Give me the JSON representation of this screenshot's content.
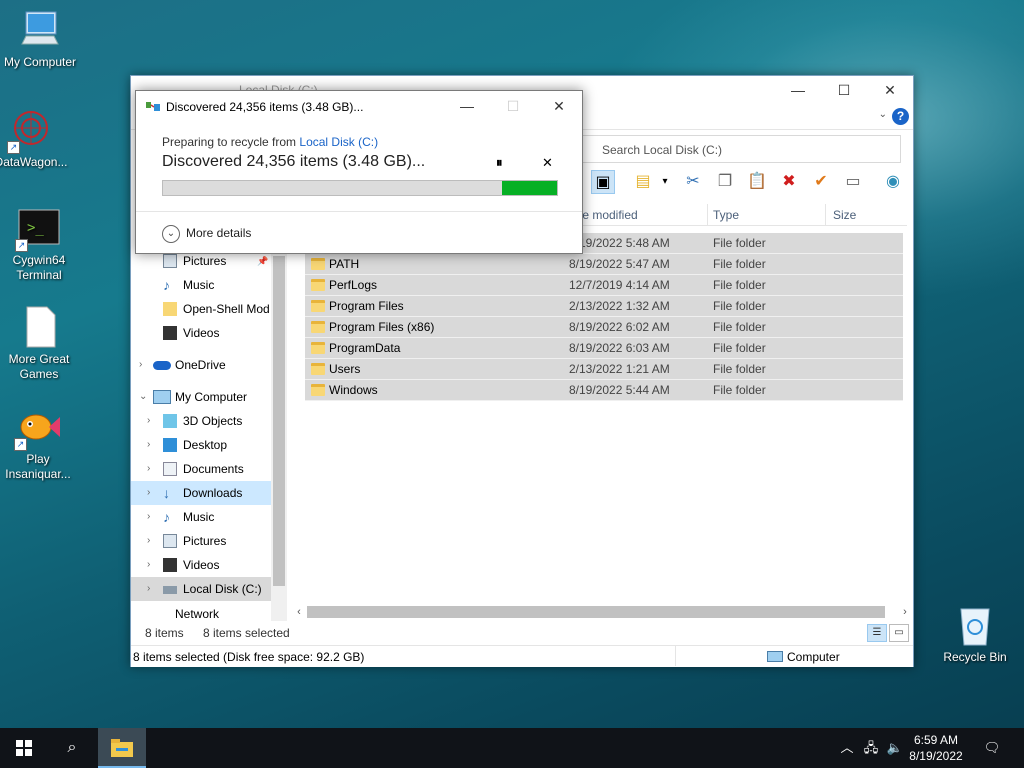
{
  "desktop": {
    "icons": [
      {
        "label": "My Computer",
        "icon": "computer-icon"
      },
      {
        "label": "DataWagon...",
        "icon": "datawagon-icon"
      },
      {
        "label": "Cygwin64 Terminal",
        "icon": "terminal-icon"
      },
      {
        "label": "More Great Games",
        "icon": "document-icon"
      },
      {
        "label": "Play Insaniquar...",
        "icon": "fish-icon"
      },
      {
        "label": "Recycle Bin",
        "icon": "recycle-bin-icon"
      }
    ]
  },
  "explorer": {
    "title": "Local Disk (C:)",
    "search_placeholder": "Search Local Disk (C:)",
    "columns": {
      "date": "te modified",
      "type": "Type",
      "size": "Size"
    },
    "files": [
      {
        "name": "",
        "date": "8/19/2022 5:48 AM",
        "type": "File folder"
      },
      {
        "name": "PATH",
        "date": "8/19/2022 5:47 AM",
        "type": "File folder"
      },
      {
        "name": "PerfLogs",
        "date": "12/7/2019 4:14 AM",
        "type": "File folder"
      },
      {
        "name": "Program Files",
        "date": "2/13/2022 1:32 AM",
        "type": "File folder"
      },
      {
        "name": "Program Files (x86)",
        "date": "8/19/2022 6:02 AM",
        "type": "File folder"
      },
      {
        "name": "ProgramData",
        "date": "8/19/2022 6:03 AM",
        "type": "File folder"
      },
      {
        "name": "Users",
        "date": "2/13/2022 1:21 AM",
        "type": "File folder"
      },
      {
        "name": "Windows",
        "date": "8/19/2022 5:44 AM",
        "type": "File folder"
      }
    ],
    "nav": [
      {
        "label": "Pictures",
        "icon": "pictures-icon"
      },
      {
        "label": "Music",
        "icon": "music-icon"
      },
      {
        "label": "Open-Shell Mod",
        "icon": "folder-icon"
      },
      {
        "label": "Videos",
        "icon": "videos-icon"
      },
      {
        "label": "OneDrive",
        "icon": "onedrive-icon"
      },
      {
        "label": "My Computer",
        "icon": "computer-icon"
      },
      {
        "label": "3D Objects",
        "icon": "3d-objects-icon"
      },
      {
        "label": "Desktop",
        "icon": "desktop-icon"
      },
      {
        "label": "Documents",
        "icon": "documents-icon"
      },
      {
        "label": "Downloads",
        "icon": "downloads-icon"
      },
      {
        "label": "Music",
        "icon": "music-icon"
      },
      {
        "label": "Pictures",
        "icon": "pictures-icon"
      },
      {
        "label": "Videos",
        "icon": "videos-icon"
      },
      {
        "label": "Local Disk (C:)",
        "icon": "drive-icon"
      },
      {
        "label": "Network",
        "icon": "network-icon"
      }
    ],
    "status": {
      "items": "8 items",
      "selected": "8 items selected",
      "bottom_left": "8 items selected (Disk free space: 92.2 GB)",
      "bottom_right": "Computer"
    }
  },
  "dialog": {
    "title": "Discovered 24,356 items (3.48 GB)...",
    "subtitle_prefix": "Preparing to recycle from ",
    "subtitle_link": "Local Disk (C:)",
    "main": "Discovered 24,356 items (3.48 GB)...",
    "progress_percent": 86,
    "more_details": "More details"
  },
  "taskbar": {
    "time": "6:59 AM",
    "date": "8/19/2022"
  },
  "colors": {
    "accent": "#1a64c8",
    "progress_green": "#06b025",
    "selection": "#d9d9d9"
  }
}
